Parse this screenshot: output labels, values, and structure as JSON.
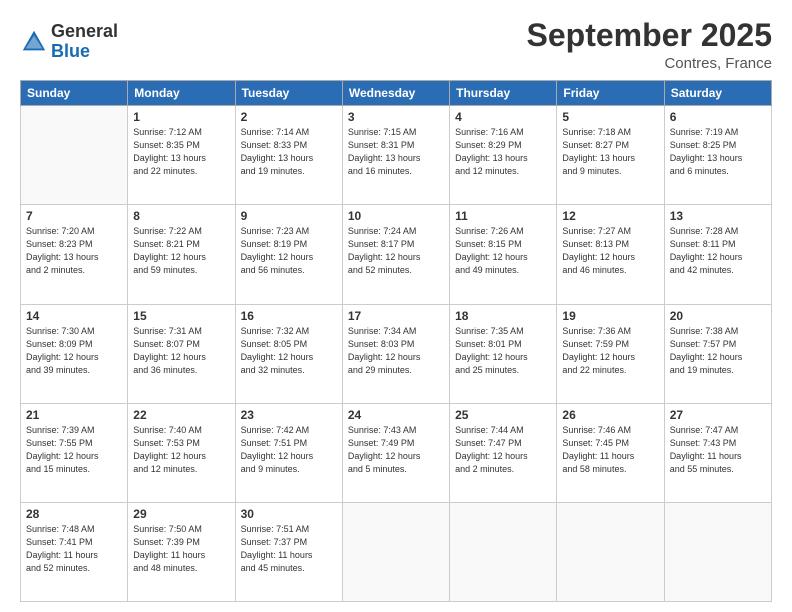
{
  "logo": {
    "general": "General",
    "blue": "Blue"
  },
  "title": "September 2025",
  "subtitle": "Contres, France",
  "days_header": [
    "Sunday",
    "Monday",
    "Tuesday",
    "Wednesday",
    "Thursday",
    "Friday",
    "Saturday"
  ],
  "weeks": [
    [
      {
        "day": "",
        "info": ""
      },
      {
        "day": "1",
        "info": "Sunrise: 7:12 AM\nSunset: 8:35 PM\nDaylight: 13 hours\nand 22 minutes."
      },
      {
        "day": "2",
        "info": "Sunrise: 7:14 AM\nSunset: 8:33 PM\nDaylight: 13 hours\nand 19 minutes."
      },
      {
        "day": "3",
        "info": "Sunrise: 7:15 AM\nSunset: 8:31 PM\nDaylight: 13 hours\nand 16 minutes."
      },
      {
        "day": "4",
        "info": "Sunrise: 7:16 AM\nSunset: 8:29 PM\nDaylight: 13 hours\nand 12 minutes."
      },
      {
        "day": "5",
        "info": "Sunrise: 7:18 AM\nSunset: 8:27 PM\nDaylight: 13 hours\nand 9 minutes."
      },
      {
        "day": "6",
        "info": "Sunrise: 7:19 AM\nSunset: 8:25 PM\nDaylight: 13 hours\nand 6 minutes."
      }
    ],
    [
      {
        "day": "7",
        "info": "Sunrise: 7:20 AM\nSunset: 8:23 PM\nDaylight: 13 hours\nand 2 minutes."
      },
      {
        "day": "8",
        "info": "Sunrise: 7:22 AM\nSunset: 8:21 PM\nDaylight: 12 hours\nand 59 minutes."
      },
      {
        "day": "9",
        "info": "Sunrise: 7:23 AM\nSunset: 8:19 PM\nDaylight: 12 hours\nand 56 minutes."
      },
      {
        "day": "10",
        "info": "Sunrise: 7:24 AM\nSunset: 8:17 PM\nDaylight: 12 hours\nand 52 minutes."
      },
      {
        "day": "11",
        "info": "Sunrise: 7:26 AM\nSunset: 8:15 PM\nDaylight: 12 hours\nand 49 minutes."
      },
      {
        "day": "12",
        "info": "Sunrise: 7:27 AM\nSunset: 8:13 PM\nDaylight: 12 hours\nand 46 minutes."
      },
      {
        "day": "13",
        "info": "Sunrise: 7:28 AM\nSunset: 8:11 PM\nDaylight: 12 hours\nand 42 minutes."
      }
    ],
    [
      {
        "day": "14",
        "info": "Sunrise: 7:30 AM\nSunset: 8:09 PM\nDaylight: 12 hours\nand 39 minutes."
      },
      {
        "day": "15",
        "info": "Sunrise: 7:31 AM\nSunset: 8:07 PM\nDaylight: 12 hours\nand 36 minutes."
      },
      {
        "day": "16",
        "info": "Sunrise: 7:32 AM\nSunset: 8:05 PM\nDaylight: 12 hours\nand 32 minutes."
      },
      {
        "day": "17",
        "info": "Sunrise: 7:34 AM\nSunset: 8:03 PM\nDaylight: 12 hours\nand 29 minutes."
      },
      {
        "day": "18",
        "info": "Sunrise: 7:35 AM\nSunset: 8:01 PM\nDaylight: 12 hours\nand 25 minutes."
      },
      {
        "day": "19",
        "info": "Sunrise: 7:36 AM\nSunset: 7:59 PM\nDaylight: 12 hours\nand 22 minutes."
      },
      {
        "day": "20",
        "info": "Sunrise: 7:38 AM\nSunset: 7:57 PM\nDaylight: 12 hours\nand 19 minutes."
      }
    ],
    [
      {
        "day": "21",
        "info": "Sunrise: 7:39 AM\nSunset: 7:55 PM\nDaylight: 12 hours\nand 15 minutes."
      },
      {
        "day": "22",
        "info": "Sunrise: 7:40 AM\nSunset: 7:53 PM\nDaylight: 12 hours\nand 12 minutes."
      },
      {
        "day": "23",
        "info": "Sunrise: 7:42 AM\nSunset: 7:51 PM\nDaylight: 12 hours\nand 9 minutes."
      },
      {
        "day": "24",
        "info": "Sunrise: 7:43 AM\nSunset: 7:49 PM\nDaylight: 12 hours\nand 5 minutes."
      },
      {
        "day": "25",
        "info": "Sunrise: 7:44 AM\nSunset: 7:47 PM\nDaylight: 12 hours\nand 2 minutes."
      },
      {
        "day": "26",
        "info": "Sunrise: 7:46 AM\nSunset: 7:45 PM\nDaylight: 11 hours\nand 58 minutes."
      },
      {
        "day": "27",
        "info": "Sunrise: 7:47 AM\nSunset: 7:43 PM\nDaylight: 11 hours\nand 55 minutes."
      }
    ],
    [
      {
        "day": "28",
        "info": "Sunrise: 7:48 AM\nSunset: 7:41 PM\nDaylight: 11 hours\nand 52 minutes."
      },
      {
        "day": "29",
        "info": "Sunrise: 7:50 AM\nSunset: 7:39 PM\nDaylight: 11 hours\nand 48 minutes."
      },
      {
        "day": "30",
        "info": "Sunrise: 7:51 AM\nSunset: 7:37 PM\nDaylight: 11 hours\nand 45 minutes."
      },
      {
        "day": "",
        "info": ""
      },
      {
        "day": "",
        "info": ""
      },
      {
        "day": "",
        "info": ""
      },
      {
        "day": "",
        "info": ""
      }
    ]
  ]
}
